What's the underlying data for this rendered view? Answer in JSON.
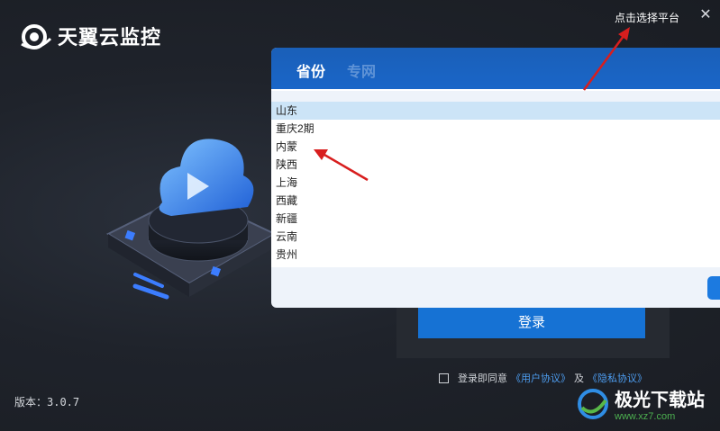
{
  "app": {
    "title": "天翼云监控"
  },
  "header": {
    "hint": "点击选择平台",
    "close_label": "✕"
  },
  "tabs": [
    {
      "label": "省份",
      "active": true
    },
    {
      "label": "专网",
      "active": false
    }
  ],
  "provinces": [
    "山东",
    "重庆2期",
    "内蒙",
    "陕西",
    "上海",
    "西藏",
    "新疆",
    "云南",
    "贵州"
  ],
  "selected_province": "山东",
  "login": {
    "button_label": "登录"
  },
  "agreement": {
    "prefix": "登录即同意",
    "user_link": "《用户协议》",
    "joiner": "及",
    "privacy_link": "《隐私协议》"
  },
  "footer": {
    "version": "版本：3.0.7"
  },
  "watermark": {
    "title": "极光下载站",
    "url": "www.xz7.com"
  },
  "colors": {
    "accent": "#1672d4",
    "tab_bar": "#1a66c8",
    "selected_row": "#cce4f7",
    "annotation_red": "#d81e1e"
  }
}
